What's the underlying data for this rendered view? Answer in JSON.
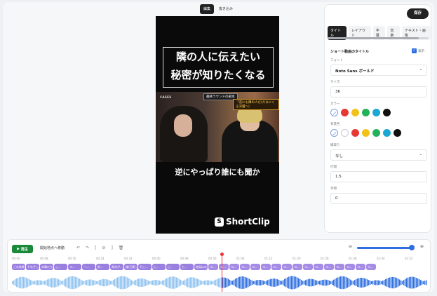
{
  "mode_tabs": [
    {
      "label": "編集",
      "active": true
    },
    {
      "label": "抜き込み",
      "active": false
    }
  ],
  "video": {
    "headline_line1": "隣の人に伝えたい",
    "headline_line2": "秘密が知りたくなる",
    "tag_a": "最終ラウンドの部本",
    "tag_b": "「逆にも隣の人だけ(なにくる深層へ)",
    "cases_text": "CASES",
    "subtitle": "逆にやっぱり誰にも聞か",
    "logo_text": "ShortClip"
  },
  "panel": {
    "save_label": "保存",
    "tabs": [
      {
        "label": "タイトル",
        "active": true
      },
      {
        "label": "レイアウト",
        "active": false
      },
      {
        "label": "字幕",
        "active": false
      },
      {
        "label": "音楽",
        "active": false
      },
      {
        "label": "テキスト・画像",
        "active": false
      }
    ],
    "section_title": "ショート動画のタイトル",
    "show_label": "表示",
    "font_label": "フォント",
    "font_value": "Noto Sans ボールド",
    "size_label": "サイズ",
    "size_value": "36",
    "color_label": "カラー",
    "colors": [
      "#e53935",
      "#f2c21b",
      "#22b35a",
      "#1aa7d4",
      "#111111"
    ],
    "bg_label": "背景色",
    "bg_colors": [
      "#ffffff",
      "#e53935",
      "#f2c21b",
      "#22b35a",
      "#1aa7d4",
      "#111111"
    ],
    "outline_label": "縁取り",
    "outline_value": "なし",
    "line_label": "行間",
    "line_value": "1.5",
    "spacing_label": "字間",
    "spacing_value": "0"
  },
  "timeline": {
    "play_label": "再生",
    "move_start_label": "開始地点へ移動",
    "ruler": [
      "00:00",
      "00:08",
      "00:16",
      "00:24",
      "00:32",
      "00:40",
      "00:48",
      "00:56",
      "01:04",
      "01:12",
      "01:20",
      "01:28",
      "01:36",
      "01:44",
      "01:52"
    ],
    "clips": [
      "ごれ結果...",
      "それぞし...",
      "本場だち...",
      "こ...",
      "ヨ...",
      "一...",
      "約...",
      "具合が...",
      "誰(元朝...",
      "そこ...",
      "に...",
      "ご...",
      "と...",
      "結局はれ...",
      "ヨ...",
      "ヨ...",
      "ヨ...",
      "ヨ...",
      "ヨ...",
      "ヨ...",
      "ヨ...",
      "ヨ...",
      "ヨ...",
      "ヨ...",
      "ヨ...",
      "ヨ...",
      "ヨ...",
      "ヨ...",
      "ヨ...",
      "ヨ..."
    ],
    "zoom_level": 0.95
  },
  "accent_color": "#2f6fe0"
}
